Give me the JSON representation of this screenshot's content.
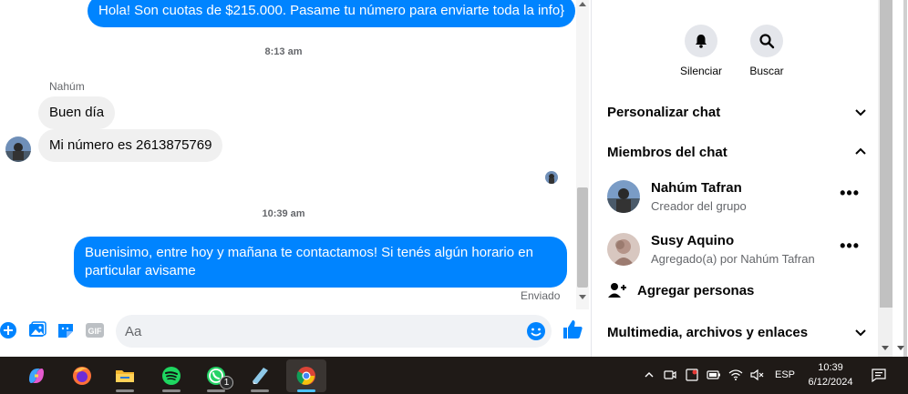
{
  "messages": {
    "top_outgoing": "Hola! Son cuotas de $215.000. Pasame tu número para enviarte toda la info}",
    "timestamp_1": "8:13 am",
    "sender_name": "Nahúm",
    "incoming_1": "Buen día",
    "incoming_2": "Mi número es 2613875769",
    "timestamp_2": "10:39 am",
    "outgoing_line1": "Buenisimo, entre hoy y mañana te contactamos! Si tenés algún horario en",
    "outgoing_line2": "particular avisame",
    "status": "Enviado"
  },
  "composer": {
    "placeholder": "Aa"
  },
  "info_panel": {
    "actions": [
      {
        "label": "Silenciar",
        "icon": "bell-icon"
      },
      {
        "label": "Buscar",
        "icon": "search-icon"
      }
    ],
    "sections": {
      "customize": "Personalizar chat",
      "members": "Miembros del chat",
      "media": "Multimedia, archivos y enlaces"
    },
    "members": [
      {
        "name": "Nahúm Tafran",
        "role": "Creador del grupo"
      },
      {
        "name": "Susy Aquino",
        "role": "Agregado(a) por Nahúm Tafran"
      }
    ],
    "add_people": "Agregar personas"
  },
  "taskbar": {
    "apps": [
      "copilot-icon",
      "firefox-icon",
      "file-explorer-icon",
      "spotify-icon",
      "whatsapp-icon",
      "notes-icon",
      "chrome-icon"
    ],
    "whatsapp_badge": "1",
    "language": "ESP",
    "time": "10:39",
    "date": "6/12/2024"
  },
  "colors": {
    "messenger_blue": "#0084ff",
    "bubble_gray": "#f0f0f0",
    "taskbar_bg": "#1f1a17"
  }
}
